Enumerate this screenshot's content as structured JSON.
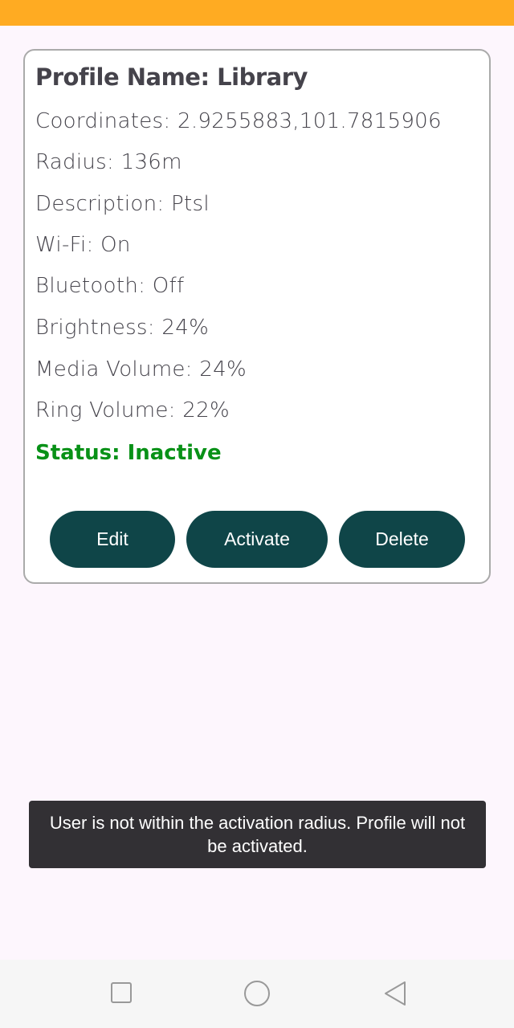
{
  "profile": {
    "title": "Profile Name: Library",
    "lines": [
      "Coordinates: 2.9255883,101.7815906",
      "Radius: 136m",
      "Description: Ptsl",
      "Wi-Fi: On",
      "Bluetooth: Off",
      "Brightness: 24%",
      "Media Volume: 24%",
      "Ring Volume: 22%"
    ],
    "status": "Status: Inactive"
  },
  "buttons": {
    "edit": "Edit",
    "activate": "Activate",
    "delete": "Delete"
  },
  "toast": "User is not within the activation radius. Profile will not be activated.",
  "colors": {
    "accent": "#ffab22",
    "button": "#0f4548",
    "status": "#089117"
  }
}
